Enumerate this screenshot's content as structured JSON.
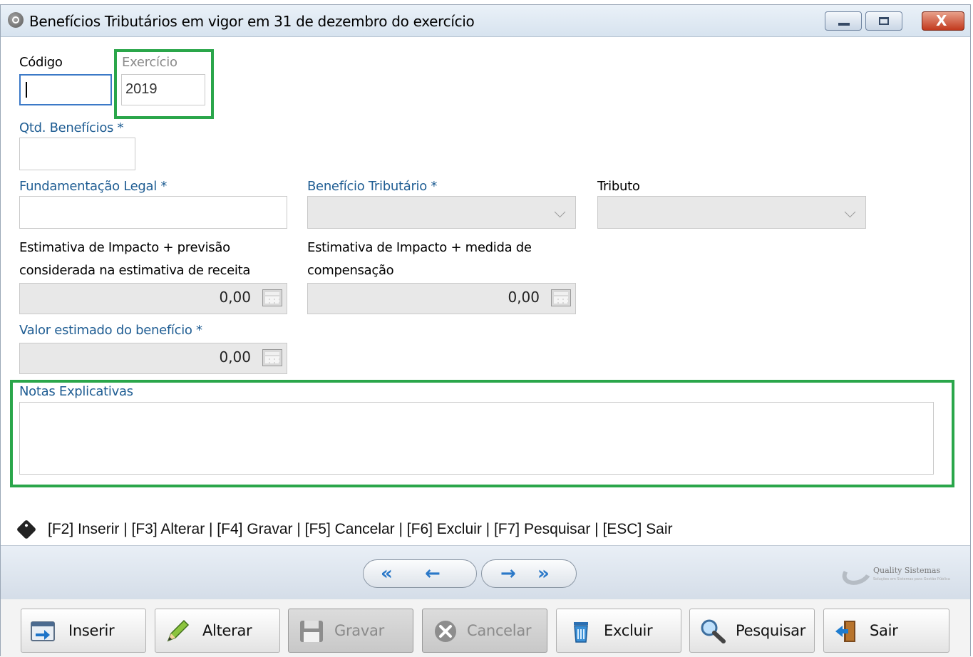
{
  "window": {
    "title": "Benefícios Tributários em vigor em 31 de dezembro do exercício",
    "minimize_icon": "minimize-icon",
    "maximize_icon": "maximize-icon",
    "close_icon": "close-icon",
    "close_glyph": "X"
  },
  "form": {
    "codigo": {
      "label": "Código",
      "value": ""
    },
    "exercicio": {
      "label": "Exercício",
      "value": "2019"
    },
    "qtd_beneficios": {
      "label": "Qtd. Benefícios *",
      "value": ""
    },
    "fundamentacao_legal": {
      "label": "Fundamentação Legal *",
      "value": ""
    },
    "beneficio_tributario": {
      "label": "Benefício Tributário *",
      "value": ""
    },
    "tributo": {
      "label": "Tributo",
      "value": ""
    },
    "estimativa_previsao": {
      "label_line1": "Estimativa de Impacto + previsão",
      "label_line2": "considerada na estimativa de receita",
      "value": "0,00"
    },
    "estimativa_compensacao": {
      "label_line1": "Estimativa de Impacto + medida de",
      "label_line2": "compensação",
      "value": "0,00"
    },
    "valor_estimado": {
      "label": "Valor estimado do benefício *",
      "value": "0,00"
    },
    "notas_explicativas": {
      "label": "Notas Explicativas",
      "value": ""
    }
  },
  "shortcuts": {
    "text": "[F2] Inserir | [F3] Alterar | [F4] Gravar | [F5] Cancelar | [F6] Excluir | [F7] Pesquisar | [ESC] Sair"
  },
  "navigation": {
    "first": "«",
    "prev": "←",
    "next": "→",
    "last": "»"
  },
  "brand": {
    "name": "Quality Sistemas",
    "tagline": "Soluções em Sistemas para Gestão Pública"
  },
  "toolbar": {
    "buttons": [
      {
        "label": "Inserir",
        "enabled": true
      },
      {
        "label": "Alterar",
        "enabled": true
      },
      {
        "label": "Gravar",
        "enabled": false
      },
      {
        "label": "Cancelar",
        "enabled": false
      },
      {
        "label": "Excluir",
        "enabled": true
      },
      {
        "label": "Pesquisar",
        "enabled": true
      },
      {
        "label": "Sair",
        "enabled": true
      }
    ]
  },
  "colors": {
    "required_label": "#1f5d93",
    "highlight_box": "#2aa64a",
    "nav_arrow": "#2a78c8"
  }
}
